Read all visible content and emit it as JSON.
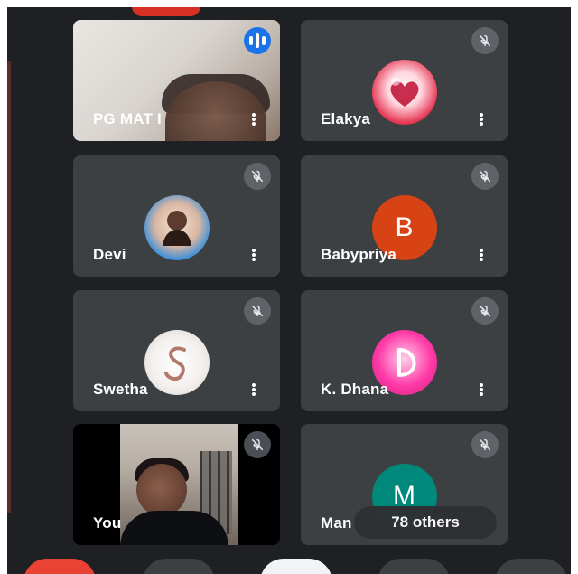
{
  "colors": {
    "background": "#1f2023",
    "tile": "#3c4043",
    "mute_badge": "#5f6368",
    "speaking_badge": "#1a73e8",
    "leave_button": "#ea4335",
    "avatar_b": "#d84315",
    "avatar_m": "#00897b"
  },
  "icons": {
    "mic_muted": "mic-off-icon",
    "speaking": "audio-levels-icon",
    "more": "more-vert-icon"
  },
  "participants": [
    {
      "name": "PG MAT I",
      "state": "speaking"
    },
    {
      "name": "Elakya",
      "state": "muted"
    },
    {
      "name": "Devi",
      "state": "muted"
    },
    {
      "name": "Babypriya",
      "state": "muted",
      "avatar_letter": "B"
    },
    {
      "name": "Swetha",
      "state": "muted"
    },
    {
      "name": "K. Dhana",
      "state": "muted"
    },
    {
      "name": "You",
      "state": "muted"
    },
    {
      "name": "Man",
      "state": "muted",
      "avatar_letter": "M"
    }
  ],
  "others_overlay": "78 others"
}
